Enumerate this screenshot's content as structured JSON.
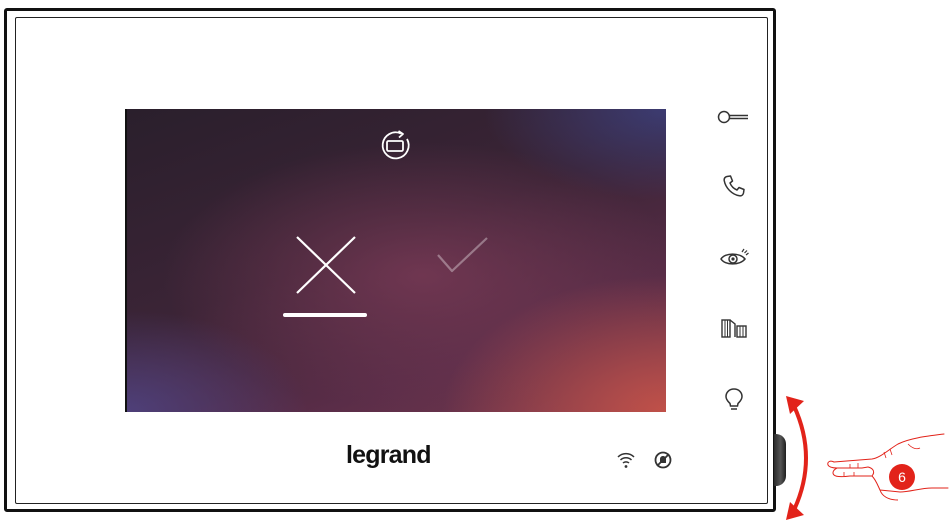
{
  "device": {
    "brand": "legrand",
    "screen": {
      "rotate_icon": "screen-rotate-icon",
      "cancel_icon": "close-icon",
      "confirm_icon": "check-icon",
      "selected_option": "cancel"
    },
    "side_buttons": [
      {
        "name": "key-icon"
      },
      {
        "name": "phone-icon"
      },
      {
        "name": "eye-icon"
      },
      {
        "name": "gate-icon"
      },
      {
        "name": "lightbulb-icon"
      }
    ],
    "status_icons": [
      "wifi-icon",
      "do-not-disturb-icon"
    ]
  },
  "callout": {
    "label": "6",
    "color": "#e2231a"
  },
  "colors": {
    "accent": "#e2231a",
    "frame": "#111111",
    "icon": "#333333"
  }
}
